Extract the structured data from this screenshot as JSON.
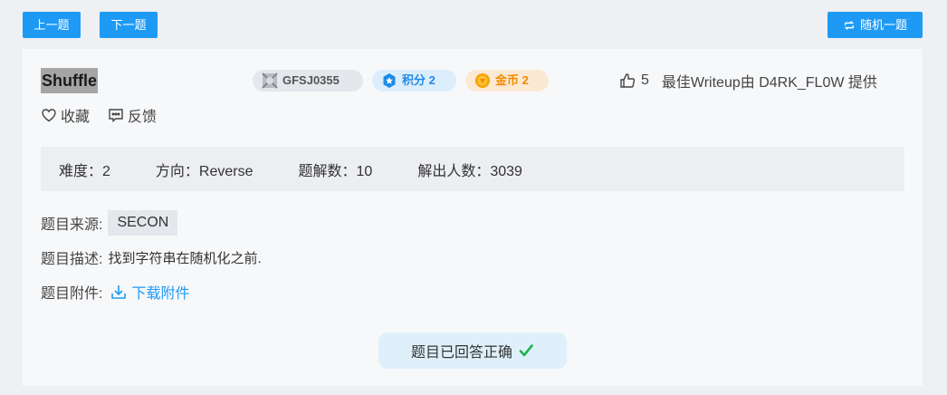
{
  "nav": {
    "prev_label": "上一题",
    "next_label": "下一题",
    "random_label": "随机一题"
  },
  "challenge": {
    "title": "Shuffle",
    "id_tag": "GFSJ0355",
    "score_tag": "积分 2",
    "coin_tag": "金币 2",
    "likes": "5",
    "writeup_text": "最佳Writeup由 D4RK_FL0W 提供",
    "favorite_label": "收藏",
    "feedback_label": "反馈"
  },
  "stats": {
    "difficulty": "难度：2",
    "direction": "方向：Reverse",
    "solves": "题解数：10",
    "solvers": "解出人数：3039"
  },
  "details": {
    "source_label": "题目来源:",
    "source_value": "SECON",
    "desc_label": "题目描述:",
    "desc_value": "找到字符串在随机化之前.",
    "attach_label": "题目附件:",
    "attach_link": "下载附件"
  },
  "status": {
    "answered_text": "题目已回答正确"
  },
  "colors": {
    "accent": "#1e9af5",
    "score_text": "#1e8ae8",
    "coin_text": "#f08c00",
    "success_check": "#22b24c"
  },
  "icons": {
    "random": "shuffle-icon",
    "id_tag": "badge-icon",
    "score": "star-badge-icon",
    "coin": "coin-icon",
    "likes": "thumbs-up-icon",
    "favorite": "heart-icon",
    "feedback": "feedback-icon",
    "download": "download-icon",
    "answered": "check-icon"
  }
}
